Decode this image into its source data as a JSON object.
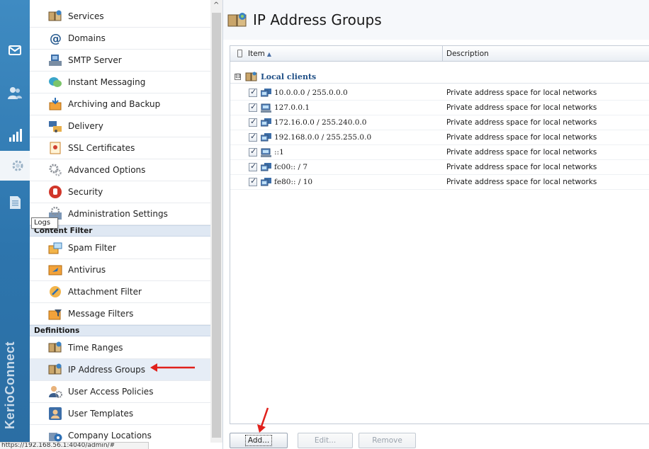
{
  "brand": {
    "name": "KerioConnect"
  },
  "rail": {
    "items": [
      {
        "icon": "mail-icon"
      },
      {
        "icon": "users-icon"
      },
      {
        "icon": "statistics-icon"
      },
      {
        "icon": "configuration-gear-icon"
      },
      {
        "icon": "logs-icon"
      }
    ],
    "tooltip": "Logs"
  },
  "nav": {
    "items": [
      {
        "label": "Services",
        "icon": "services-icon"
      },
      {
        "label": "Domains",
        "icon": "at-sign-icon"
      },
      {
        "label": "SMTP Server",
        "icon": "smtp-server-icon"
      },
      {
        "label": "Instant Messaging",
        "icon": "chat-bubbles-icon"
      },
      {
        "label": "Archiving and Backup",
        "icon": "archive-icon"
      },
      {
        "label": "Delivery",
        "icon": "delivery-icon"
      },
      {
        "label": "SSL Certificates",
        "icon": "certificate-icon"
      },
      {
        "label": "Advanced Options",
        "icon": "gears-icon"
      },
      {
        "label": "Security",
        "icon": "security-stop-icon"
      },
      {
        "label": "Administration Settings",
        "icon": "admin-settings-icon"
      }
    ],
    "section_content_filter": "Content Filter",
    "content_filter_items": [
      {
        "label": "Spam Filter",
        "icon": "spam-filter-icon"
      },
      {
        "label": "Antivirus",
        "icon": "antivirus-icon"
      },
      {
        "label": "Attachment Filter",
        "icon": "attachment-filter-icon"
      },
      {
        "label": "Message Filters",
        "icon": "message-filters-icon"
      }
    ],
    "section_definitions": "Definitions",
    "definitions_items": [
      {
        "label": "Time Ranges",
        "icon": "time-ranges-icon"
      },
      {
        "label": "IP Address Groups",
        "icon": "ip-address-groups-icon",
        "selected": true
      },
      {
        "label": "User Access Policies",
        "icon": "user-access-policies-icon"
      },
      {
        "label": "User Templates",
        "icon": "user-templates-icon"
      },
      {
        "label": "Company Locations",
        "icon": "company-locations-icon"
      }
    ]
  },
  "status_url": "https://192.168.56.1:4040/admin/#",
  "main": {
    "title": "IP Address Groups",
    "columns": {
      "item": "Item",
      "description": "Description"
    },
    "group": {
      "label": "Local clients",
      "expander": "⊟"
    },
    "rows": [
      {
        "checked": true,
        "item": "10.0.0.0 / 255.0.0.0",
        "description": "Private address space for local networks"
      },
      {
        "checked": true,
        "item": "127.0.0.1",
        "description": "Private address space for local networks"
      },
      {
        "checked": true,
        "item": "172.16.0.0 / 255.240.0.0",
        "description": "Private address space for local networks"
      },
      {
        "checked": true,
        "item": "192.168.0.0 / 255.255.0.0",
        "description": "Private address space for local networks"
      },
      {
        "checked": true,
        "item": "::1",
        "description": "Private address space for local networks"
      },
      {
        "checked": true,
        "item": "fc00:: / 7",
        "description": "Private address space for local networks"
      },
      {
        "checked": true,
        "item": "fe80:: / 10",
        "description": "Private address space for local networks"
      }
    ],
    "buttons": {
      "add": "Add...",
      "edit": "Edit...",
      "remove": "Remove"
    }
  },
  "colors": {
    "rail": "#2d75ad",
    "section_header": "#dfe8f3",
    "selected_row": "#e6edf6",
    "annotation_arrow": "#e0201b",
    "group_label": "#1f4f86"
  }
}
